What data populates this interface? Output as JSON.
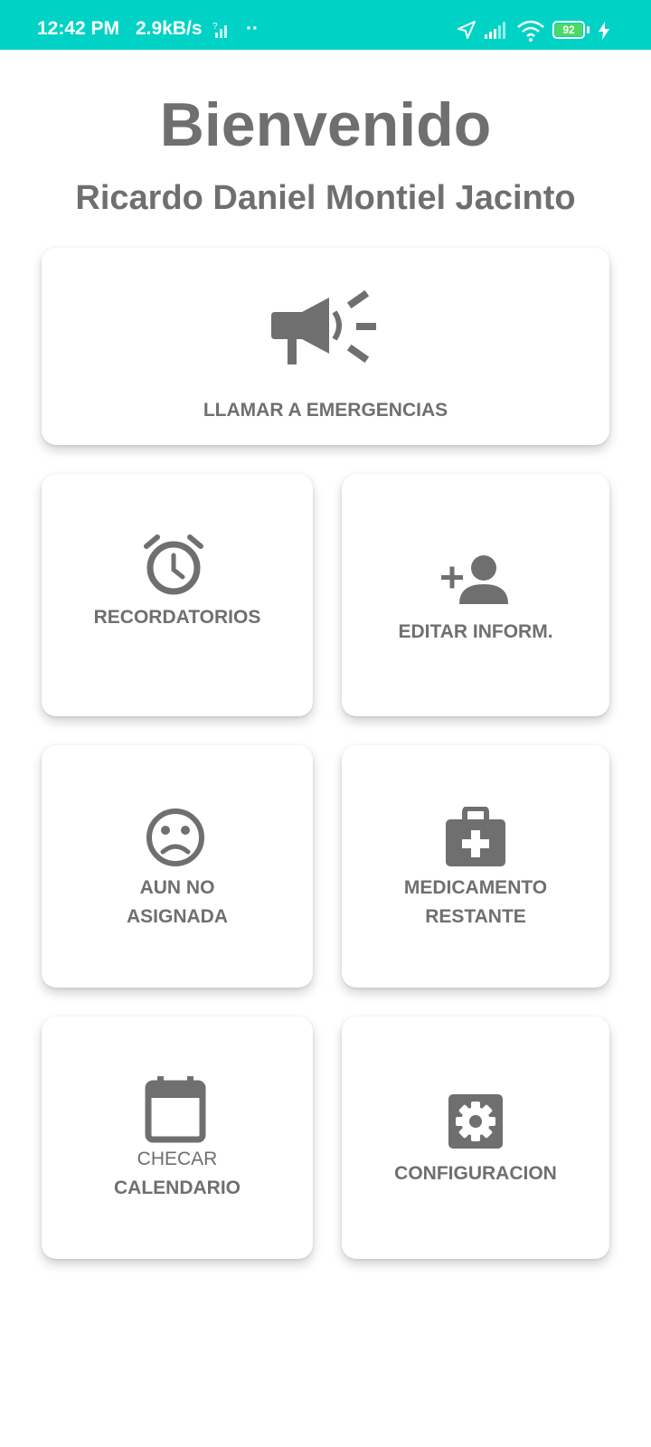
{
  "status_bar": {
    "time": "12:42 PM",
    "network_speed": "2.9kB/s",
    "dots": "··",
    "battery_level": "92",
    "background_color": "#00d3c5"
  },
  "header": {
    "title": "Bienvenido",
    "user_name": "Ricardo Daniel Montiel Jacinto"
  },
  "cards": {
    "emergency": {
      "label": "LLAMAR A EMERGENCIAS",
      "icon": "megaphone-icon"
    },
    "reminders": {
      "label": "RECORDATORIOS",
      "icon": "alarm-clock-icon"
    },
    "edit_info": {
      "label": "EDITAR INFORM.",
      "icon": "add-person-icon"
    },
    "unassigned": {
      "label_line1": "AUN NO",
      "label_line2": "ASIGNADA",
      "icon": "sad-face-icon"
    },
    "medicine": {
      "label_line1": "MEDICAMENTO",
      "label_line2": "RESTANTE",
      "icon": "medical-kit-icon"
    },
    "calendar": {
      "label_line1": "CHECAR",
      "label_line2": "CALENDARIO",
      "icon": "calendar-icon"
    },
    "settings": {
      "label": "CONFIGURACION",
      "icon": "gear-icon"
    }
  },
  "colors": {
    "text_gray": "#6f6f6f",
    "accent_teal": "#00d3c5",
    "battery_green": "#4cd964"
  }
}
